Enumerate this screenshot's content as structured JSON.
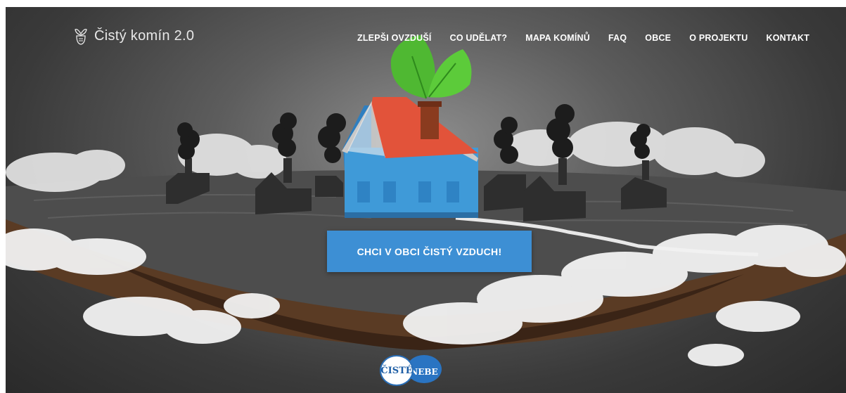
{
  "brand": {
    "name": "Čistý komín 2.0",
    "icon": "chimney-leaf-icon"
  },
  "nav": {
    "items": [
      {
        "label": "ZLEPŠI OVZDUŠÍ"
      },
      {
        "label": "CO UDĚLAT?"
      },
      {
        "label": "MAPA KOMÍNŮ"
      },
      {
        "label": "FAQ"
      },
      {
        "label": "OBCE"
      },
      {
        "label": "O PROJEKTU"
      },
      {
        "label": "KONTAKT"
      }
    ]
  },
  "hero": {
    "cta_label": "CHCI V OBCI ČISTÝ VZDUCH!"
  },
  "partner_logo": {
    "left_text": "ČISTÉ",
    "right_text": "NEBE"
  },
  "colors": {
    "accent": "#3d8fd4",
    "roof": "#e2533a",
    "house": "#3f9ad8",
    "leaf": "#4fb832"
  }
}
